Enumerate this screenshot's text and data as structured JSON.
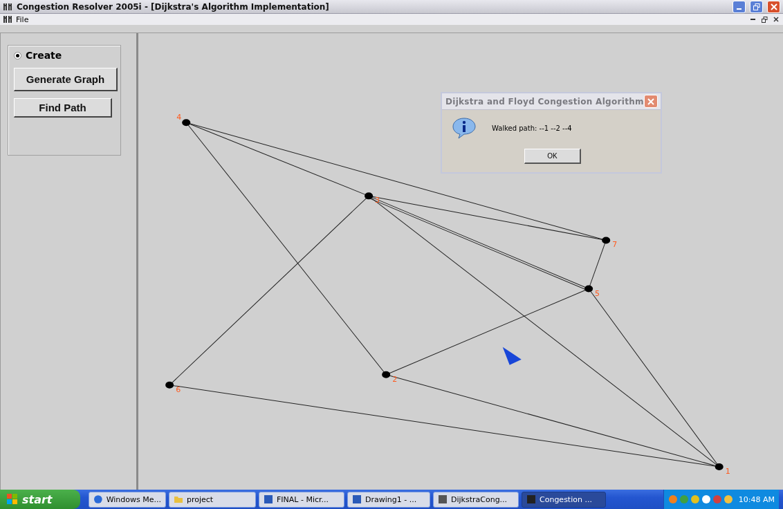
{
  "window": {
    "title": "Congestion Resolver 2005i - [Dijkstra's Algorithm Implementation]"
  },
  "menu_bar": {
    "items": [
      "File"
    ]
  },
  "left_panel": {
    "radio": {
      "label": "Create",
      "selected": true
    },
    "buttons": [
      "Generate Graph",
      "Find Path"
    ]
  },
  "graph": {
    "nodes": [
      {
        "label": "4"
      },
      {
        "label": "3"
      },
      {
        "label": "7"
      },
      {
        "label": "5"
      },
      {
        "label": "2"
      },
      {
        "label": "6"
      },
      {
        "label": "1"
      }
    ]
  },
  "dialog": {
    "title": "Dijkstra and Floyd Congestion Algorithm",
    "message": "Walked path: --1 --2 --4",
    "button": "OK"
  },
  "taskbar": {
    "start": "start",
    "tasks": [
      {
        "label": "Windows Me...",
        "selected": false
      },
      {
        "label": "project",
        "selected": false
      },
      {
        "label": "FINAL - Micr...",
        "selected": false
      },
      {
        "label": "Drawing1 - ...",
        "selected": false
      },
      {
        "label": "DijkstraCong...",
        "selected": false
      },
      {
        "label": "Congestion ...",
        "selected": true
      }
    ],
    "clock": "10:48 AM"
  }
}
